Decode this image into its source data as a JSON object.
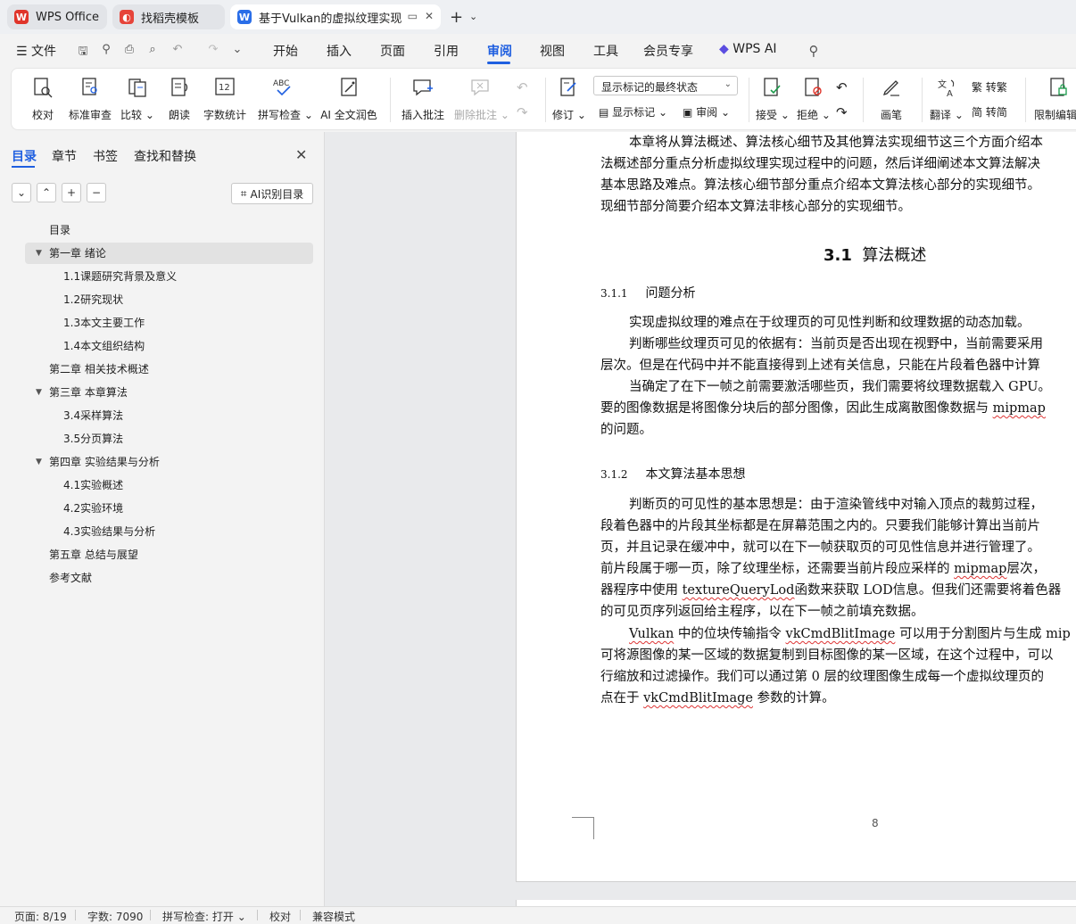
{
  "tabs": {
    "wps": "WPS Office",
    "template": "找稻壳模板",
    "doc": "基于Vulkan的虚拟纹理实现"
  },
  "menu": {
    "file": "文件",
    "items": [
      "开始",
      "插入",
      "页面",
      "引用",
      "审阅",
      "视图",
      "工具",
      "会员专享",
      "WPS AI"
    ],
    "active": "审阅"
  },
  "ribbon": {
    "proofread": "校对",
    "standard_review": "标准审查",
    "compare": "比较",
    "read_aloud": "朗读",
    "word_count": "字数统计",
    "spell_check": "拼写检查",
    "ai_polish": "AI 全文润色",
    "insert_comment": "插入批注",
    "delete_comment": "删除批注",
    "track_changes": "修订",
    "markup_display": "显示标记的最终状态",
    "show_markup": "显示标记",
    "review": "审阅",
    "accept": "接受",
    "reject": "拒绝",
    "pen": "画笔",
    "translate": "翻译",
    "to_traditional": "转繁",
    "to_simplified": "转简",
    "restrict_edit": "限制编辑"
  },
  "nav": {
    "tabs": [
      "目录",
      "章节",
      "书签",
      "查找和替换"
    ],
    "ai_toc": "AI识别目录",
    "toc": [
      {
        "label": "目录",
        "level": 1,
        "arrow": ""
      },
      {
        "label": "第一章 绪论",
        "level": 1,
        "arrow": "▼",
        "selected": true
      },
      {
        "label": "1.1课题研究背景及意义",
        "level": 2,
        "arrow": ""
      },
      {
        "label": "1.2研究现状",
        "level": 2,
        "arrow": ""
      },
      {
        "label": "1.3本文主要工作",
        "level": 2,
        "arrow": ""
      },
      {
        "label": "1.4本文组织结构",
        "level": 2,
        "arrow": ""
      },
      {
        "label": "第二章 相关技术概述",
        "level": 1,
        "arrow": ""
      },
      {
        "label": "第三章 本章算法",
        "level": 1,
        "arrow": "▼"
      },
      {
        "label": "3.4采样算法",
        "level": 2,
        "arrow": ""
      },
      {
        "label": "3.5分页算法",
        "level": 2,
        "arrow": ""
      },
      {
        "label": "第四章 实验结果与分析",
        "level": 1,
        "arrow": "▼"
      },
      {
        "label": "4.1实验概述",
        "level": 2,
        "arrow": ""
      },
      {
        "label": "4.2实验环境",
        "level": 2,
        "arrow": ""
      },
      {
        "label": "4.3实验结果与分析",
        "level": 2,
        "arrow": ""
      },
      {
        "label": "第五章 总结与展望",
        "level": 1,
        "arrow": ""
      },
      {
        "label": "参考文献",
        "level": 1,
        "arrow": ""
      }
    ]
  },
  "document": {
    "intro": [
      "本章将从算法概述、算法核心细节及其他算法实现细节这三个方面介绍本",
      "法概述部分重点分析虚拟纹理实现过程中的问题，然后详细阐述本文算法解决",
      "基本思路及难点。算法核心细节部分重点介绍本文算法核心部分的实现细节。",
      "现细节部分简要介绍本文算法非核心部分的实现细节。"
    ],
    "section_num": "3.1",
    "section_title": "算法概述",
    "sub1_num": "3.1.1",
    "sub1_title": "问题分析",
    "sub1_lines": [
      "实现虚拟纹理的难点在于纹理页的可见性判断和纹理数据的动态加载。",
      "判断哪些纹理页可见的依据有：当前页是否出现在视野中，当前需要采用",
      "层次。但是在代码中并不能直接得到上述有关信息，只能在片段着色器中计算",
      "当确定了在下一帧之前需要激活哪些页，我们需要将纹理数据载入 GPU。",
      "要的图像数据是将图像分块后的部分图像，因此生成离散图像数据与 mipmap",
      "的问题。"
    ],
    "sub2_num": "3.1.2",
    "sub2_title": "本文算法基本思想",
    "sub2_lines": [
      "判断页的可见性的基本思想是：由于渲染管线中对输入顶点的裁剪过程，",
      "段着色器中的片段其坐标都是在屏幕范围之内的。只要我们能够计算出当前片",
      "页，并且记录在缓冲中，就可以在下一帧获取页的可见性信息并进行管理了。",
      "前片段属于哪一页，除了纹理坐标，还需要当前片段应采样的 mipmap层次，",
      "器程序中使用 textureQueryLod函数来获取 LOD信息。但我们还需要将着色器",
      "的可见页序列返回给主程序，以在下一帧之前填充数据。",
      "Vulkan 中的位块传输指令 vkCmdBlitImage 可以用于分割图片与生成 mip",
      "可将源图像的某一区域的数据复制到目标图像的某一区域，在这个过程中，可以",
      "行缩放和过滤操作。我们可以通过第 0 层的纹理图像生成每一个虚拟纹理页的",
      "点在于 vkCmdBlitImage 参数的计算。"
    ],
    "page_number": "8"
  },
  "status": {
    "page": "页面: 8/19",
    "words": "字数: 7090",
    "spell": "拼写检查: 打开",
    "proof": "校对",
    "compat": "兼容模式"
  },
  "colors": {
    "accent": "#1f5fe0",
    "wps_red": "#e0352b",
    "docer_red": "#e6443a",
    "doc_blue": "#2a6ee8"
  }
}
